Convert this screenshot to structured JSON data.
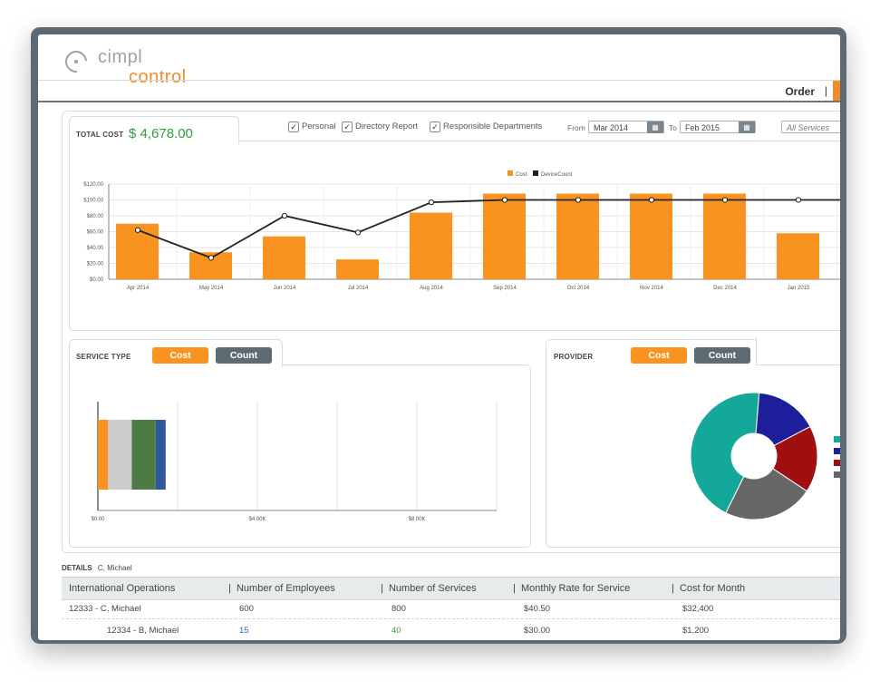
{
  "logo": {
    "top": "cimpl",
    "bottom": "control"
  },
  "nav": {
    "order": "Order",
    "separator": "|"
  },
  "summary": {
    "total_cost_label": "TOTAL COST",
    "total_cost_value": "$ 4,678.00"
  },
  "filters": {
    "personal": "Personal",
    "directory_report": "Directory Report",
    "responsible_departments": "Responsible Departments",
    "from_label": "From",
    "from_value": "Mar 2014",
    "to_label": "To",
    "to_value": "Feb 2015",
    "services": "All Services"
  },
  "chart_data": [
    {
      "type": "bar",
      "categories": [
        "Apr 2014",
        "May 2014",
        "Jun 2014",
        "Jul 2014",
        "Aug 2014",
        "Sep 2014",
        "Oct 2014",
        "Nov 2014",
        "Dec 2014",
        "Jan 2015"
      ],
      "series": [
        {
          "name": "Cost",
          "type": "bar",
          "color": "#f7931e",
          "values": [
            70,
            34,
            54,
            25,
            84,
            108,
            108,
            108,
            108,
            58
          ]
        },
        {
          "name": "DeviceCount",
          "type": "line",
          "color": "#222222",
          "values": [
            62,
            27,
            80,
            59,
            97,
            100,
            100,
            100,
            100,
            100
          ]
        }
      ],
      "yticks": [
        "$0.00",
        "$20.00",
        "$40.00",
        "$60.00",
        "$80.00",
        "$100.00",
        "$120.00"
      ],
      "ylim": [
        0,
        120
      ],
      "legend": "top-center",
      "grid": true
    },
    {
      "type": "bar",
      "orientation": "horizontal-stacked",
      "segments": [
        {
          "value": 0.25,
          "color": "#f7931e"
        },
        {
          "value": 0.6,
          "color": "#cccccc"
        },
        {
          "value": 0.6,
          "color": "#4e7a44"
        },
        {
          "value": 0.25,
          "color": "#2f5a9a"
        }
      ],
      "xticks": [
        "$0.00",
        "$4.00K",
        "$8.00K"
      ],
      "xlim": [
        0,
        10
      ]
    },
    {
      "type": "pie",
      "style": "donut",
      "slices": [
        {
          "value": 44,
          "color": "#14a89a"
        },
        {
          "value": 16,
          "color": "#1e1e9a"
        },
        {
          "value": 17,
          "color": "#a00f0f"
        },
        {
          "value": 23,
          "color": "#666666"
        }
      ]
    }
  ],
  "service_type": {
    "title": "SERVICE TYPE",
    "cost_btn": "Cost",
    "count_btn": "Count"
  },
  "provider": {
    "title": "PROVIDER",
    "cost_btn": "Cost",
    "count_btn": "Count"
  },
  "details": {
    "label": "DETAILS",
    "value": "C, Michael"
  },
  "table": {
    "headers": [
      "International Operations",
      "Number of Employees",
      "Number of Services",
      "Monthly Rate for Service",
      "Cost for Month"
    ],
    "rows": [
      [
        "12333 - C, Michael",
        "600",
        "800",
        "$40.50",
        "$32,400"
      ],
      [
        "12334 - B, Michael",
        "15",
        "40",
        "$30.00",
        "$1,200"
      ]
    ]
  },
  "colors": {
    "accent": "#f7931e",
    "frame": "#5d6a73",
    "link_blue": "#2a6eb3",
    "link_green": "#3a9a3a"
  }
}
